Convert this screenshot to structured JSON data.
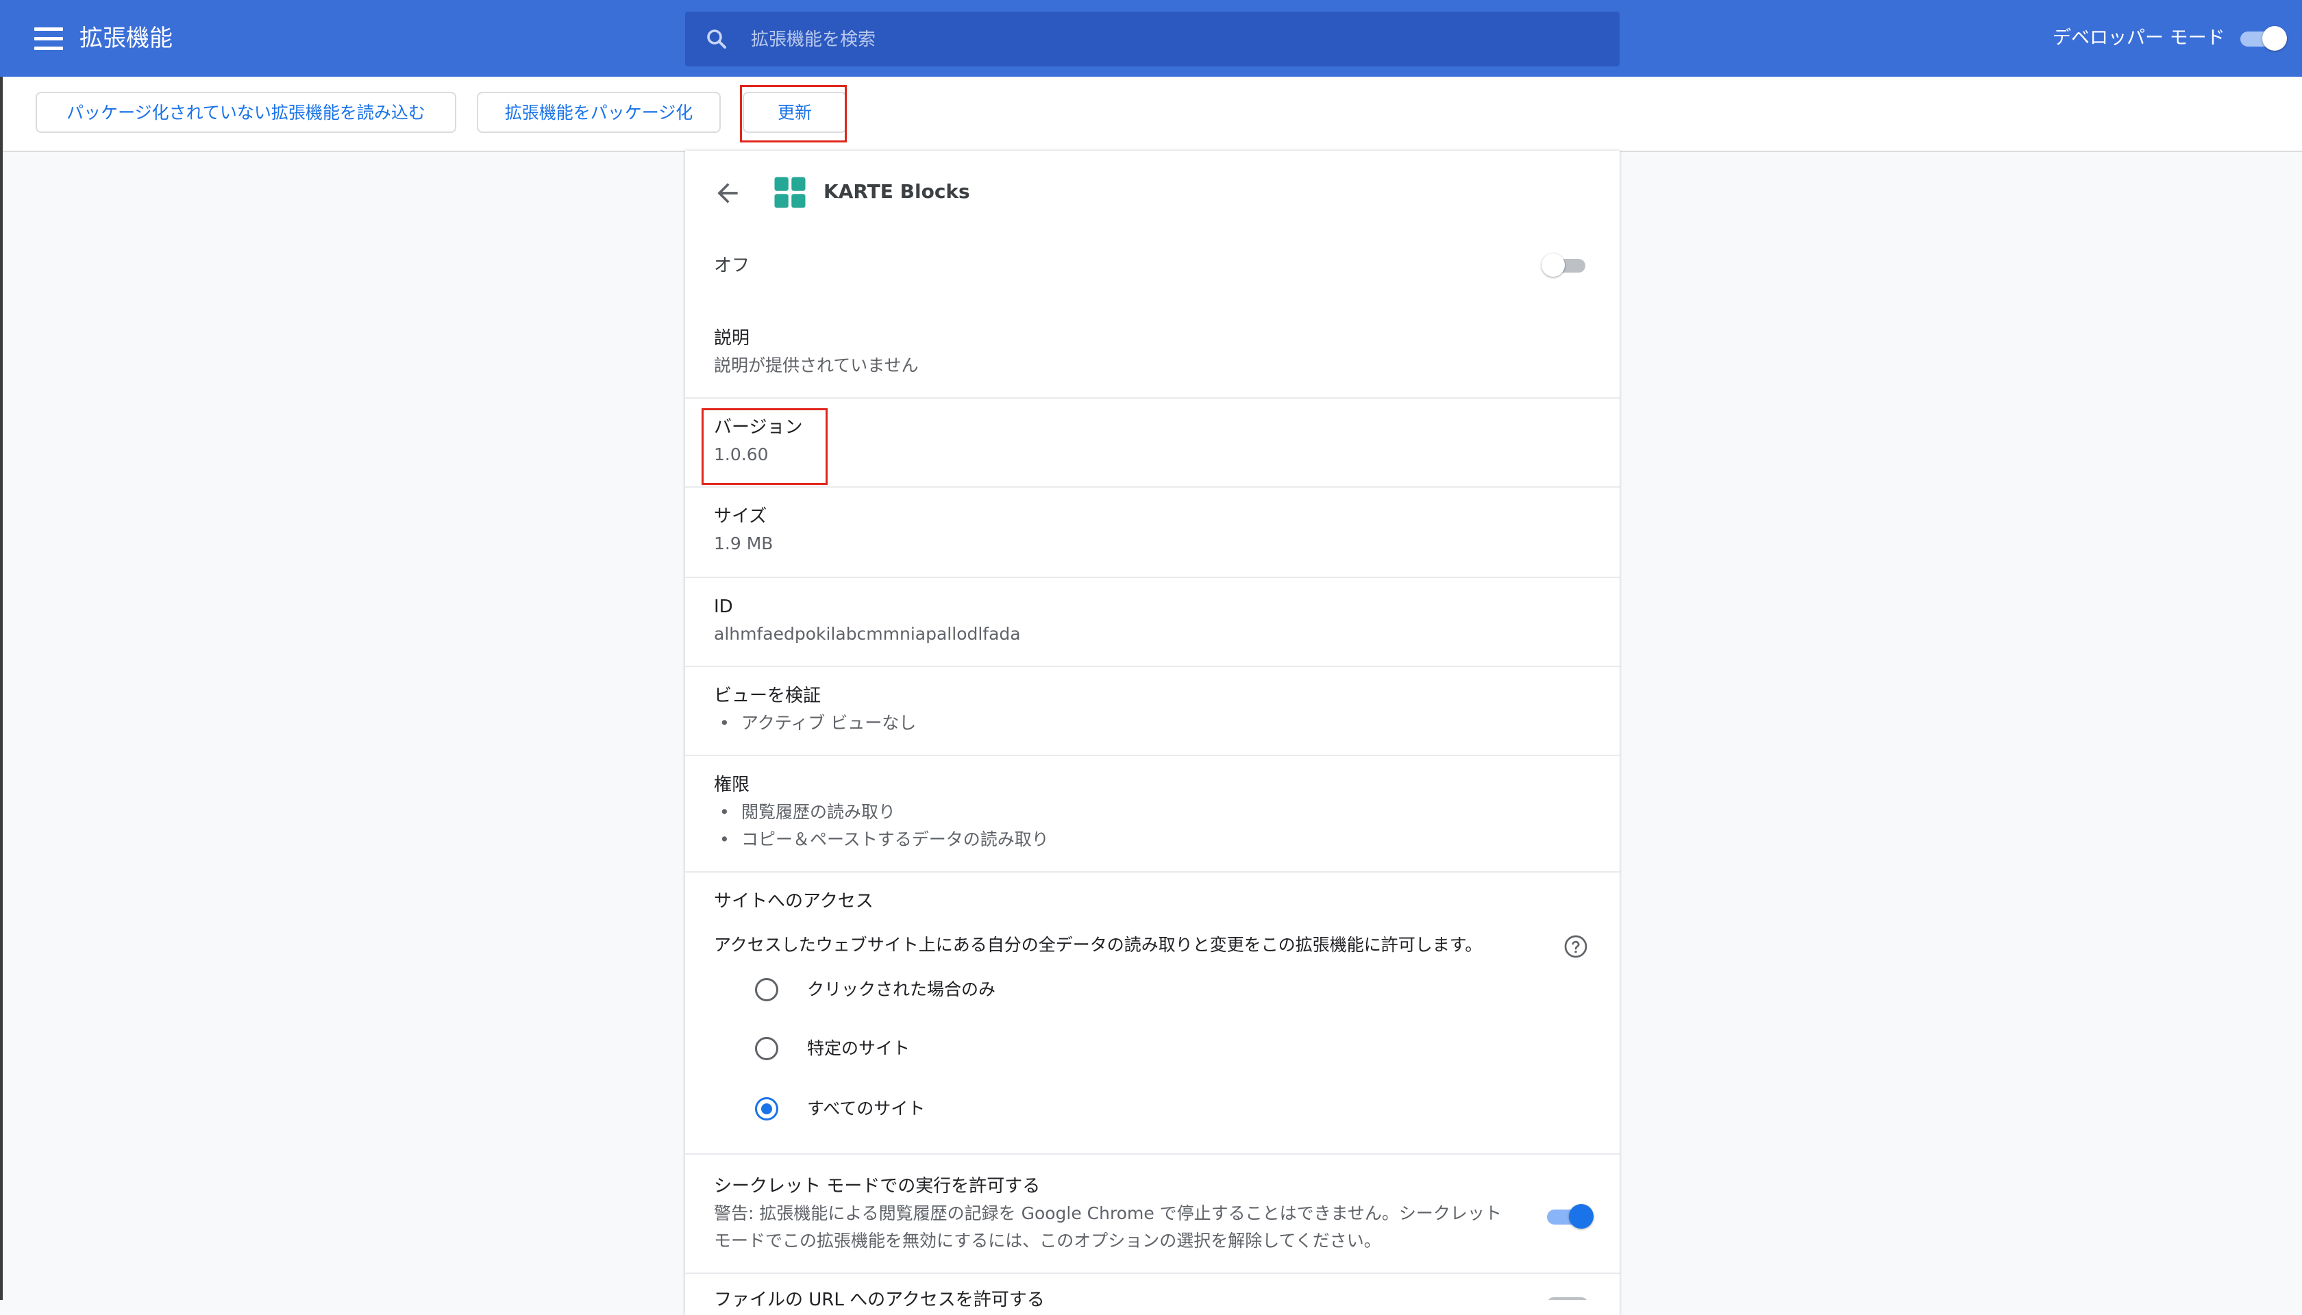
{
  "header": {
    "title": "拡張機能",
    "search_placeholder": "拡張機能を検索",
    "dev_mode_label": "デベロッパー モード",
    "dev_mode_on": true
  },
  "toolbar": {
    "load_unpacked": "パッケージ化されていない拡張機能を読み込む",
    "pack": "拡張機能をパッケージ化",
    "update": "更新"
  },
  "extension": {
    "name": "KARTE Blocks",
    "enabled_label": "オフ",
    "enabled": false,
    "description_title": "説明",
    "description_value": "説明が提供されていません",
    "version_title": "バージョン",
    "version_value": "1.0.60",
    "size_title": "サイズ",
    "size_value": "1.9 MB",
    "id_title": "ID",
    "id_value": "alhmfaedpokilabcmmniapallodlfada",
    "views_title": "ビューを検証",
    "views_items": [
      "アクティブ ビューなし"
    ],
    "permissions_title": "権限",
    "permissions_items": [
      "閲覧履歴の読み取り",
      "コピー＆ペーストするデータの読み取り"
    ],
    "site_access_title": "サイトへのアクセス",
    "site_access_desc": "アクセスしたウェブサイト上にある自分の全データの読み取りと変更をこの拡張機能に許可します。",
    "site_access_options": [
      "クリックされた場合のみ",
      "特定のサイト",
      "すべてのサイト"
    ],
    "site_access_selected": "すべてのサイト",
    "incognito_title": "シークレット モードでの実行を許可する",
    "incognito_warning_line1": "警告: 拡張機能による閲覧履歴の記録を Google Chrome で停止することはできません。シークレット",
    "incognito_warning_line2": "モードでこの拡張機能を無効にするには、このオプションの選択を解除してください。",
    "incognito_allowed": true,
    "file_urls_title": "ファイルの URL へのアクセスを許可する"
  },
  "colors": {
    "header_bg": "#3b6fd8",
    "accent": "#1a73e8",
    "highlight_box": "#e0261d",
    "brand_icon": "#25a896"
  }
}
